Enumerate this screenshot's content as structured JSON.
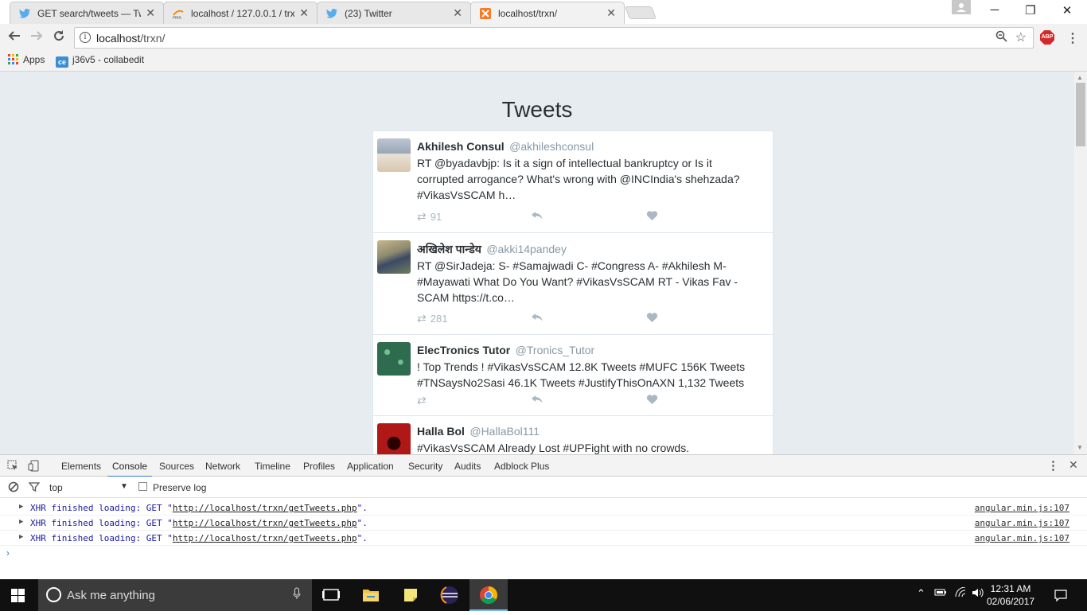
{
  "browser": {
    "tabs": [
      {
        "title": "GET search/tweets — Tw",
        "icon": "twitter-bird-icon",
        "active": false
      },
      {
        "title": "localhost / 127.0.0.1 / trx",
        "icon": "phpmyadmin-icon",
        "active": false
      },
      {
        "title": "(23) Twitter",
        "icon": "twitter-bird-icon",
        "active": false
      },
      {
        "title": "localhost/trxn/",
        "icon": "xampp-icon",
        "active": true
      }
    ],
    "close_glyph": "✕",
    "window_controls": {
      "minimize": "─",
      "restore": "❐",
      "close": "✕"
    },
    "url_host": "localhost",
    "url_path": "/trxn/",
    "abp_label": "ABP",
    "bookmarks": [
      {
        "label": "Apps",
        "icon": "apps-grid-icon"
      },
      {
        "label": "j36v5 - collabedit",
        "icon": "ce-icon",
        "badge": "ce"
      }
    ]
  },
  "page": {
    "title": "Tweets",
    "tweets": [
      {
        "name": "Akhilesh Consul",
        "handle": "@akhileshconsul",
        "text": "RT @byadavbjp: Is it a sign of intellectual bankruptcy or Is it corrupted arrogance? What's wrong with @INCIndia's shehzada? #VikasVsSCAM h…",
        "retweets": "91",
        "avatar_color": "#9aa6b5"
      },
      {
        "name": "अखिलेश पान्डेय",
        "handle": "@akki14pandey",
        "text": "RT @SirJadeja: S- #Samajwadi C- #Congress A- #Akhilesh M- #Mayawati What Do You Want? #VikasVsSCAM RT - Vikas Fav - SCAM https://t.co…",
        "retweets": "281",
        "avatar_color": "#6e7f5a"
      },
      {
        "name": "ElecTronics Tutor",
        "handle": "@Tronics_Tutor",
        "text": "! Top Trends ! #VikasVsSCAM 12.8K Tweets #MUFC 156K Tweets #TNSaysNo2Sasi 46.1K Tweets #JustifyThisOnAXN 1,132 Tweets",
        "retweets": "",
        "avatar_color": "#2f6b4f"
      },
      {
        "name": "Halla Bol",
        "handle": "@HallaBol111",
        "text": "#VikasVsSCAM Already Lost #UPFight with no crowds.",
        "retweets": "",
        "avatar_color": "#b01818"
      }
    ]
  },
  "devtools": {
    "tabs": [
      "Elements",
      "Console",
      "Sources",
      "Network",
      "Timeline",
      "Profiles",
      "Application",
      "Security",
      "Audits",
      "Adblock Plus"
    ],
    "selected_tab": "Console",
    "context": "top",
    "preserve_log": "Preserve log",
    "messages": [
      {
        "prefix": "XHR finished loading: GET \"",
        "url": "http://localhost/trxn/getTweets.php",
        "suffix": "\".",
        "source": "angular.min.js:107"
      },
      {
        "prefix": "XHR finished loading: GET \"",
        "url": "http://localhost/trxn/getTweets.php",
        "suffix": "\".",
        "source": "angular.min.js:107"
      },
      {
        "prefix": "XHR finished loading: GET \"",
        "url": "http://localhost/trxn/getTweets.php",
        "suffix": "\".",
        "source": "angular.min.js:107"
      }
    ],
    "prompt": "›"
  },
  "taskbar": {
    "search_placeholder": "Ask me anything",
    "time": "12:31 AM",
    "date": "02/06/2017"
  }
}
